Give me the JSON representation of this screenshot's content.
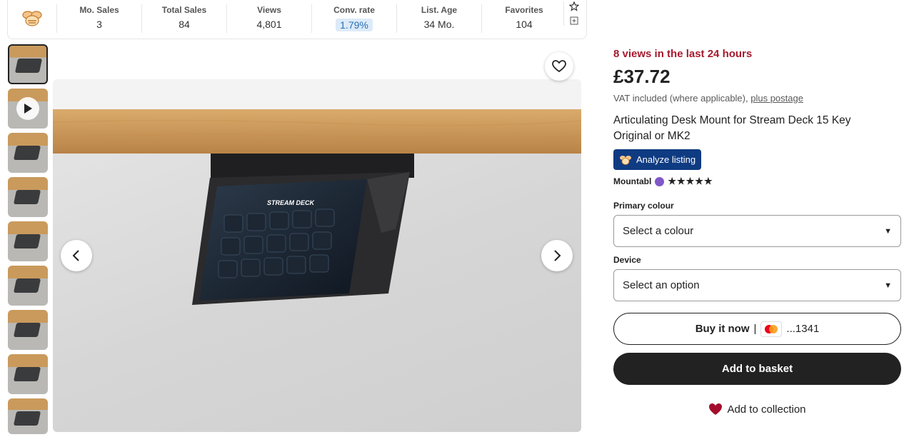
{
  "stats": [
    {
      "label": "Mo. Sales",
      "value": "3"
    },
    {
      "label": "Total Sales",
      "value": "84"
    },
    {
      "label": "Views",
      "value": "4,801"
    },
    {
      "label": "Conv. rate",
      "value": "1.79%"
    },
    {
      "label": "List. Age",
      "value": "34 Mo."
    },
    {
      "label": "Favorites",
      "value": "104"
    }
  ],
  "icons": {
    "logo": "bee-logo-icon",
    "favorite": "heart-outline-icon",
    "prev": "chevron-left-icon",
    "next": "chevron-right-icon",
    "play": "play-icon",
    "star_tool": "star-outline-icon",
    "add_tool": "add-box-icon"
  },
  "product": {
    "views_alert": "8 views in the last 24 hours",
    "price": "£37.72",
    "vat_text": "VAT included (where applicable),",
    "postage_link": "plus postage",
    "title": "Articulating Desk Mount for Stream Deck 15 Key Original or MK2",
    "analyze_label": "Analyze listing",
    "shop_name": "Mountabl",
    "stars": "★★★★★",
    "image_text": "STREAM DECK"
  },
  "options": {
    "colour_label": "Primary colour",
    "colour_value": "Select a colour",
    "device_label": "Device",
    "device_value": "Select an option"
  },
  "actions": {
    "buy_now_label": "Buy it now",
    "buy_now_separator": "|",
    "card_suffix": "...1341",
    "add_basket_label": "Add to basket",
    "add_collection_label": "Add to collection"
  },
  "colors": {
    "alert": "#a61a2e",
    "analyze_bg": "#0f3b82",
    "primary_button": "#222222",
    "collection_heart": "#a30d2b",
    "conv_pill": "#dcebf9"
  }
}
